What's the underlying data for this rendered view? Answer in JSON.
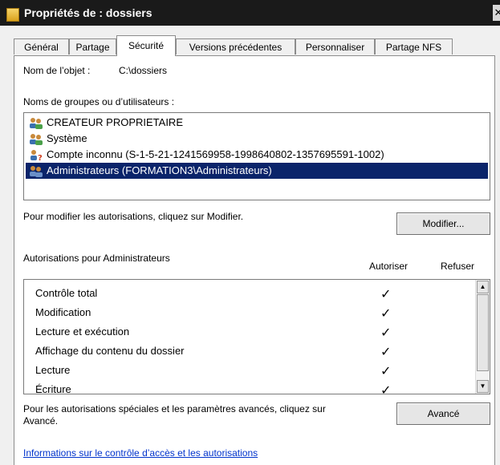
{
  "window": {
    "title": "Propriétés de : dossiers",
    "close_glyph": "✕"
  },
  "tabs": [
    {
      "label": "Général"
    },
    {
      "label": "Partage"
    },
    {
      "label": "Sécurité"
    },
    {
      "label": "Versions précédentes"
    },
    {
      "label": "Personnaliser"
    },
    {
      "label": "Partage NFS"
    }
  ],
  "active_tab": "Sécurité",
  "object": {
    "label": "Nom de l’objet :",
    "value": "C:\\dossiers"
  },
  "groups": {
    "label": "Noms de groupes ou d’utilisateurs :",
    "items": [
      {
        "label": "CREATEUR PROPRIETAIRE",
        "icon": "users-icon"
      },
      {
        "label": "Système",
        "icon": "users-icon"
      },
      {
        "label": "Compte inconnu (S-1-5-21-1241569958-1998640802-1357695591-1002)",
        "icon": "unknown-user-icon"
      },
      {
        "label": "Administrateurs (FORMATION3\\Administrateurs)",
        "icon": "users-icon",
        "selected": true
      }
    ]
  },
  "modify": {
    "hint": "Pour modifier les autorisations, cliquez sur Modifier.",
    "button_label": "Modifier..."
  },
  "permissions": {
    "label": "Autorisations pour Administrateurs",
    "col_allow": "Autoriser",
    "col_deny": "Refuser",
    "rows": [
      {
        "name": "Contrôle total",
        "allow": "✓",
        "deny": ""
      },
      {
        "name": "Modification",
        "allow": "✓",
        "deny": ""
      },
      {
        "name": "Lecture et exécution",
        "allow": "✓",
        "deny": ""
      },
      {
        "name": "Affichage du contenu du dossier",
        "allow": "✓",
        "deny": ""
      },
      {
        "name": "Lecture",
        "allow": "✓",
        "deny": ""
      },
      {
        "name": "Écriture",
        "allow": "✓",
        "deny": ""
      }
    ]
  },
  "advanced": {
    "hint_line1": "Pour les autorisations spéciales et les paramètres avancés, cliquez sur",
    "hint_line2": "Avancé.",
    "button_label": "Avancé"
  },
  "footer_link": "Informations sur le contrôle d’accès et les autorisations",
  "colors": {
    "titlebar": "#1a1a1a",
    "selection": "#0a246a",
    "link": "#0033cc"
  }
}
